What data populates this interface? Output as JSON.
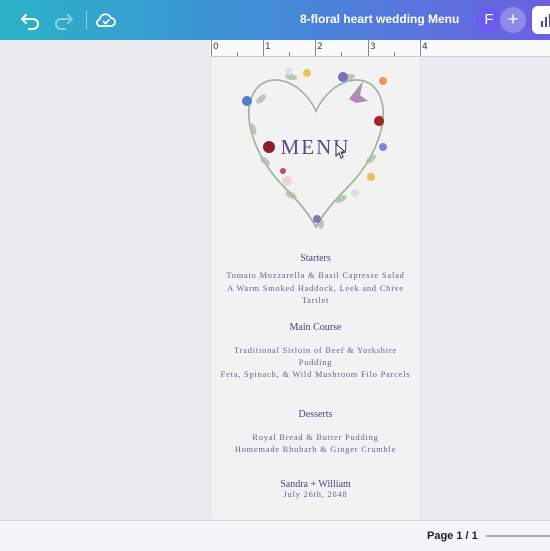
{
  "toolbar": {
    "doc_title": "8-floral heart wedding  Menu",
    "avatar_initial": "F",
    "plus_label": "+"
  },
  "ruler": {
    "labels": [
      "0",
      "1",
      "2",
      "3",
      "4"
    ]
  },
  "menu": {
    "title": "MENU",
    "sections": [
      {
        "heading": "Starters",
        "items": [
          "Tomato Mozzarella & Basil Capresse Salad",
          "A Warm Smoked Haddock, Leek and Chive Tartlet"
        ]
      },
      {
        "heading": "Main Course",
        "items": [
          "Traditional Sirloin of Beef & Yorkshire Pudding",
          "Feta, Spinach, & Wild Mushroom Filo Parcels"
        ]
      },
      {
        "heading": "Desserts",
        "items": [
          "Royal Bread & Butter Pudding",
          "Homemade Rhubarb & Ginger Crumble"
        ]
      }
    ],
    "couple": "Sandra + William",
    "date": "July 26th, 2048"
  },
  "footer": {
    "page_info": "Page 1 / 1"
  },
  "colors": {
    "accent": "#5a4a8a",
    "topbar_start": "#2ab3c7",
    "topbar_end": "#6d5fe3"
  }
}
